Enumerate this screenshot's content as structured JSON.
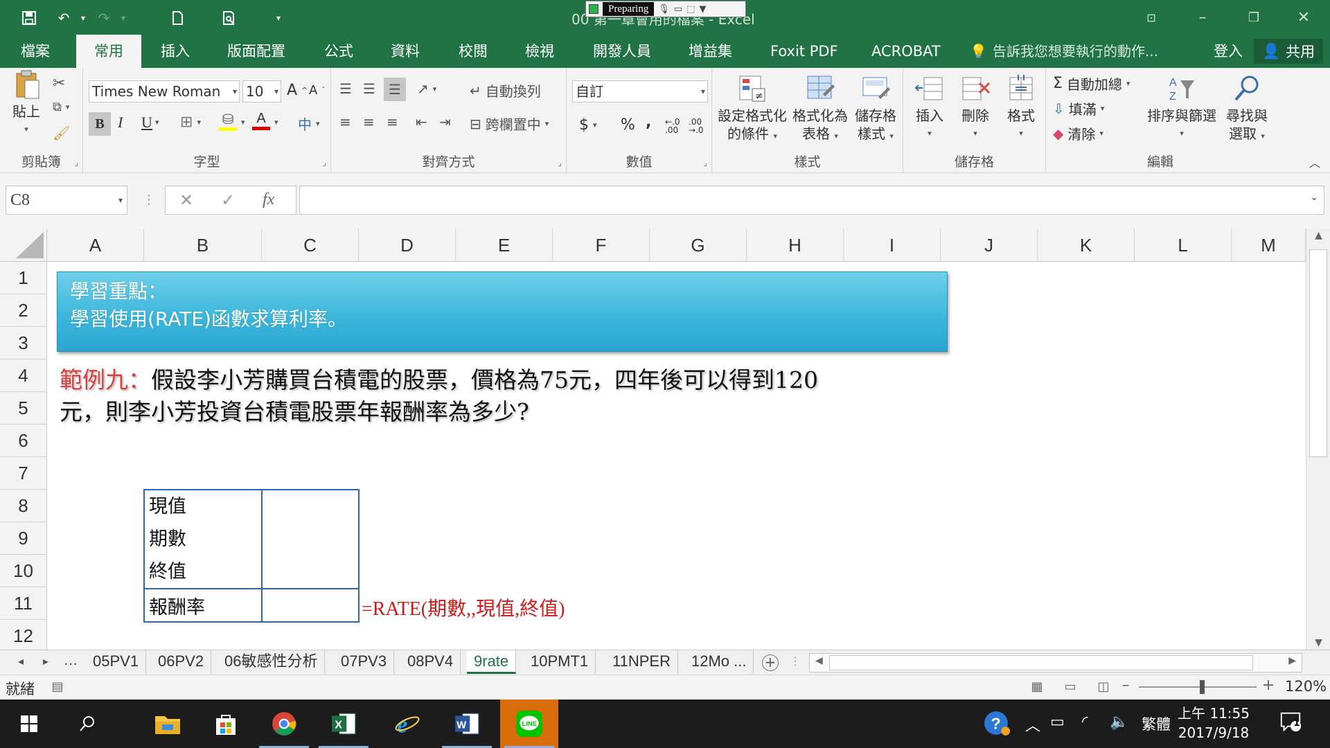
{
  "titlebar": {
    "window_title": "00 第一章會用的檔案 - Excel",
    "recording_label": "Preparing"
  },
  "ribbon_tabs": [
    "檔案",
    "常用",
    "插入",
    "版面配置",
    "公式",
    "資料",
    "校閱",
    "檢視",
    "開發人員",
    "增益集",
    "Foxit PDF",
    "ACROBAT"
  ],
  "active_tab": "常用",
  "tell_me": "告訴我您想要執行的動作...",
  "sign_in": "登入",
  "share": "共用",
  "ribbon": {
    "clipboard": {
      "paste": "貼上",
      "label": "剪貼簿"
    },
    "font": {
      "name": "Times New Roman",
      "size": "10",
      "bold": "B",
      "italic": "I",
      "underline": "U",
      "phonetic": "中",
      "label": "字型"
    },
    "alignment": {
      "wrap": "自動換列",
      "merge": "跨欄置中",
      "label": "對齊方式"
    },
    "number": {
      "format": "自訂",
      "currency": "$",
      "percent": "%",
      "comma": ",",
      "label": "數值"
    },
    "styles": {
      "conditional": [
        "設定格式化",
        "的條件"
      ],
      "as_table": [
        "格式化為",
        "表格"
      ],
      "cell_styles": [
        "儲存格",
        "樣式"
      ],
      "label": "樣式"
    },
    "cells": {
      "insert": "插入",
      "delete": "刪除",
      "format": "格式",
      "label": "儲存格"
    },
    "editing": {
      "autosum": "自動加總",
      "fill": "填滿",
      "clear": "清除",
      "sort": "排序與篩選",
      "find": [
        "尋找與",
        "選取"
      ],
      "label": "編輯"
    }
  },
  "formula_bar": {
    "name_box": "C8",
    "fx": "fx",
    "value": ""
  },
  "columns": [
    "A",
    "B",
    "C",
    "D",
    "E",
    "F",
    "G",
    "H",
    "I",
    "J",
    "K",
    "L",
    "M"
  ],
  "rows": [
    "1",
    "2",
    "3",
    "4",
    "5",
    "6",
    "7",
    "8",
    "9",
    "10",
    "11",
    "12"
  ],
  "sheet": {
    "banner": {
      "line1": "學習重點：",
      "line2": "學習使用(RATE)函數求算利率。"
    },
    "example": {
      "label": "範例九：",
      "line1": "假設李小芳購買台積電的股票，價格為75元，四年後可以得到120",
      "line2": "元，則李小芳投資台積電股票年報酬率為多少?"
    },
    "table": {
      "pv": "現值",
      "nper": "期數",
      "fv": "終值",
      "rate": "報酬率"
    },
    "formula_note": "=RATE(期數,,現值,終值)"
  },
  "sheet_tabs": [
    "05PV1",
    "06PV2",
    "06敏感性分析",
    "07PV3",
    "08PV4",
    "9rate",
    "10PMT1",
    "11NPER",
    "12Mo ..."
  ],
  "active_sheet": "9rate",
  "status": {
    "ready": "就緒",
    "zoom": "120%"
  },
  "taskbar": {
    "time": "上午 11:55",
    "date": "2017/9/18",
    "ime": "繁體",
    "notifications": "1"
  }
}
